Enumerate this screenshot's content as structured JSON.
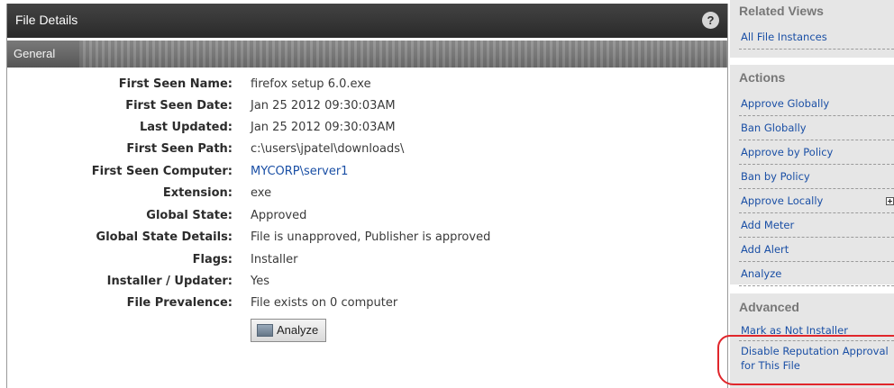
{
  "panel": {
    "title": "File Details",
    "help_symbol": "?",
    "tab_label": "General"
  },
  "details": [
    {
      "label": "First Seen Name:",
      "value": "firefox setup 6.0.exe"
    },
    {
      "label": "First Seen Date:",
      "value": "Jan 25 2012 09:30:03AM"
    },
    {
      "label": "Last Updated:",
      "value": "Jan 25 2012 09:30:03AM"
    },
    {
      "label": "First Seen Path:",
      "value": "c:\\users\\jpatel\\downloads\\"
    },
    {
      "label": "First Seen Computer:",
      "value": "MYCORP\\server1"
    },
    {
      "label": "Extension:",
      "value": "exe"
    },
    {
      "label": "Global State:",
      "value": "Approved"
    },
    {
      "label": "Global State Details:",
      "value": "File is unapproved, Publisher is approved"
    },
    {
      "label": "Flags:",
      "value": "Installer"
    },
    {
      "label": "Installer / Updater:",
      "value": "Yes"
    },
    {
      "label": "File Prevalence:",
      "value": "File exists on 0 computer"
    }
  ],
  "analyze_button_label": "Analyze",
  "sidebar": {
    "related_views": {
      "title": "Related Views",
      "items": [
        "All File Instances"
      ]
    },
    "actions": {
      "title": "Actions",
      "items": [
        "Approve Globally",
        "Ban Globally",
        "Approve by Policy",
        "Ban by Policy",
        "Approve Locally",
        "Add Meter",
        "Add Alert",
        "Analyze"
      ]
    },
    "advanced": {
      "title": "Advanced",
      "items": [
        "Mark as Not Installer",
        "Disable Reputation Approval for This File"
      ]
    }
  },
  "colors": {
    "header_bg": "#2f2f2f",
    "link": "#1a4fa5",
    "highlight": "#e0262b"
  }
}
